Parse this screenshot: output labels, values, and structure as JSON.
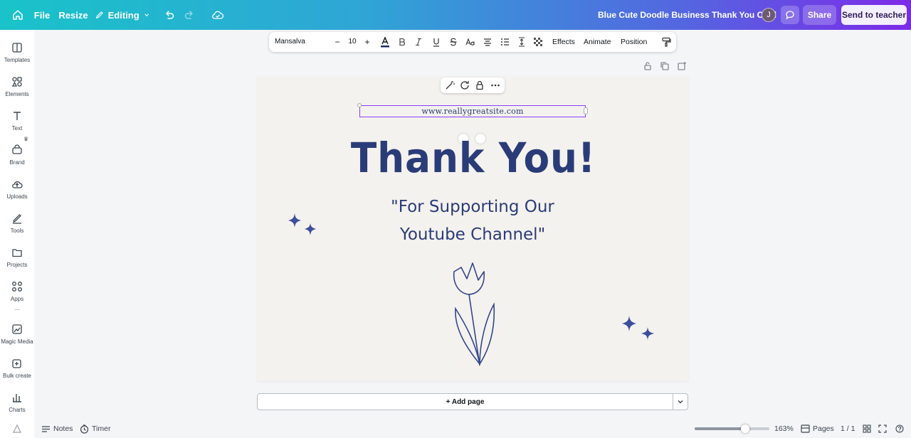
{
  "topbar": {
    "file_label": "File",
    "resize_label": "Resize",
    "editing_label": "Editing",
    "document_title": "Blue Cute Doodle Business Thank You Card",
    "avatar_initial": "J",
    "share_label": "Share",
    "send_label": "Send to teacher"
  },
  "sidebar": {
    "items": [
      {
        "label": "Templates",
        "icon": "templates-icon"
      },
      {
        "label": "Elements",
        "icon": "elements-icon"
      },
      {
        "label": "Text",
        "icon": "text-icon"
      },
      {
        "label": "Brand",
        "icon": "brand-icon"
      },
      {
        "label": "Uploads",
        "icon": "uploads-icon"
      },
      {
        "label": "Tools",
        "icon": "tools-icon"
      },
      {
        "label": "Projects",
        "icon": "projects-icon"
      },
      {
        "label": "Apps",
        "icon": "apps-icon"
      },
      {
        "label": "Magic Media",
        "icon": "magic-media-icon"
      },
      {
        "label": "Bulk create",
        "icon": "bulk-create-icon"
      },
      {
        "label": "Charts",
        "icon": "charts-icon"
      }
    ]
  },
  "text_toolbar": {
    "font_name": "Mansalva",
    "font_size": "10",
    "minus": "−",
    "plus": "+",
    "effects_label": "Effects",
    "animate_label": "Animate",
    "position_label": "Position"
  },
  "canvas": {
    "website_text": "www.reallygreatsite.com",
    "heading": "Thank You!",
    "subheading_line1": "\"For Supporting Our",
    "subheading_line2": "Youtube Channel\""
  },
  "add_page_label": "+ Add page",
  "bottombar": {
    "notes_label": "Notes",
    "timer_label": "Timer",
    "zoom_level": "163%",
    "zoom_fraction": 0.68,
    "pages_label": "Pages",
    "page_count": "1 / 1"
  },
  "colors": {
    "accent": "#8b3dff",
    "ink": "#2a3c78",
    "card_bg": "#f4f2ee"
  }
}
